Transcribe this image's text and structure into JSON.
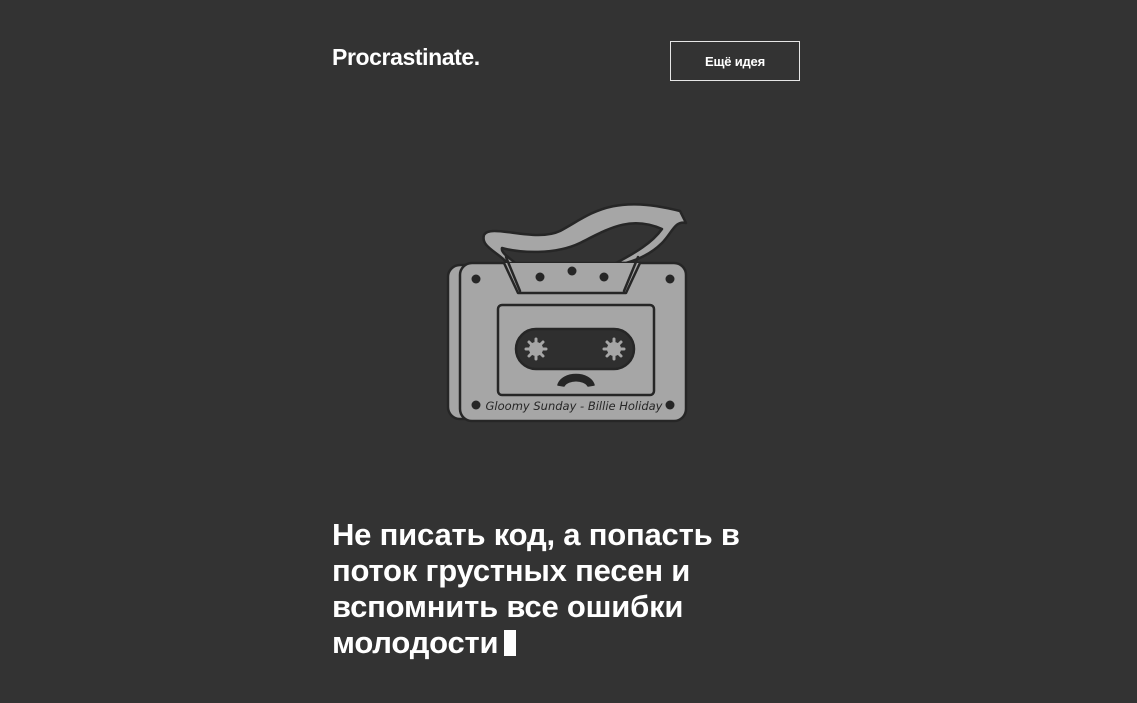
{
  "header": {
    "logo": "Procrastinate.",
    "more_button_label": "Ещё идея"
  },
  "illustration": {
    "name": "cassette-tape",
    "label": "Gloomy Sunday - Billie Holiday",
    "color": "#a6a6a6"
  },
  "idea": {
    "text": "Не писать код, а попасть в поток грустных песен и вспомнить все ошибки молодости"
  },
  "colors": {
    "background": "#333333",
    "text": "#ffffff",
    "drawing": "#a6a6a6",
    "outline": "#262626"
  }
}
